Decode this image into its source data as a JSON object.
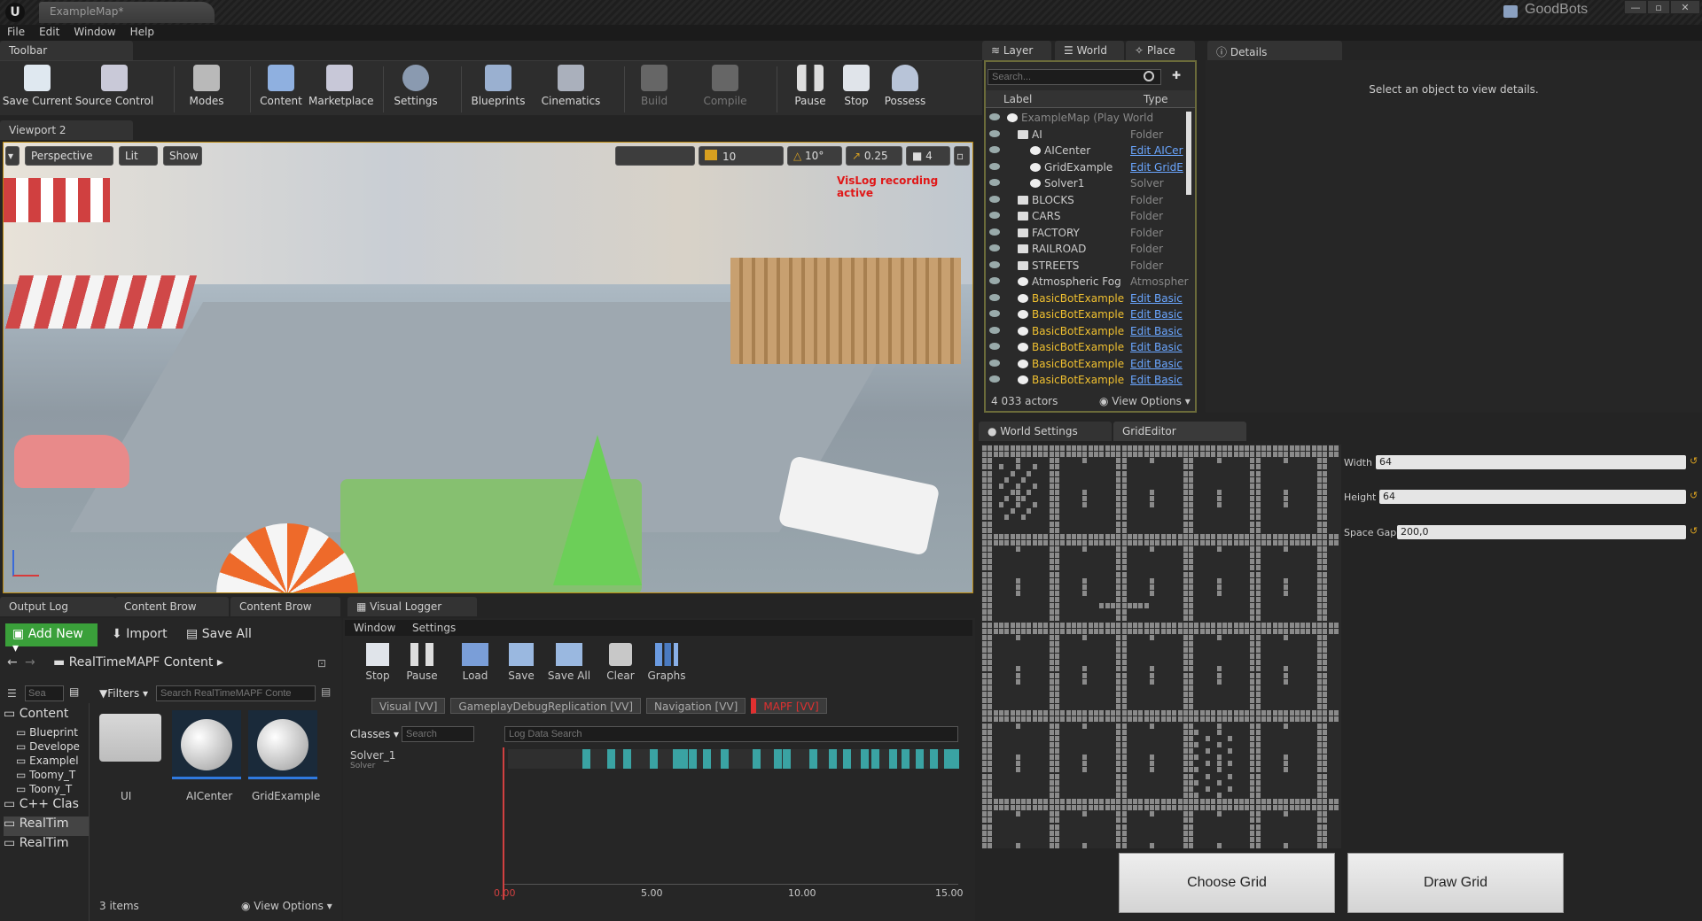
{
  "window": {
    "doc_tab": "ExampleMap*",
    "brand": "GoodBots",
    "logo": "U"
  },
  "menu": [
    "File",
    "Edit",
    "Window",
    "Help"
  ],
  "toolbar": {
    "tab": "Toolbar",
    "buttons": [
      {
        "label": "Save Current",
        "icon": "save-icon"
      },
      {
        "label": "Source Control",
        "icon": "source-control-icon"
      },
      {
        "label": "Modes",
        "icon": "modes-icon"
      },
      {
        "label": "Content",
        "icon": "content-icon"
      },
      {
        "label": "Marketplace",
        "icon": "marketplace-icon"
      },
      {
        "label": "Settings",
        "icon": "settings-icon"
      },
      {
        "label": "Blueprints",
        "icon": "blueprints-icon"
      },
      {
        "label": "Cinematics",
        "icon": "cinematics-icon"
      },
      {
        "label": "Build",
        "icon": "build-icon"
      },
      {
        "label": "Compile",
        "icon": "compile-icon"
      },
      {
        "label": "Pause",
        "icon": "pause-icon"
      },
      {
        "label": "Stop",
        "icon": "stop-icon"
      },
      {
        "label": "Possess",
        "icon": "possess-icon"
      }
    ]
  },
  "viewport": {
    "tab": "Viewport 2",
    "perspective": "Perspective",
    "lit": "Lit",
    "show": "Show",
    "grid_snap": "10",
    "rot_snap": "10°",
    "scale_snap": "0.25",
    "cam_speed": "4",
    "status": "VisLog recording active"
  },
  "outliner": {
    "tabs": [
      "Layer",
      "World",
      "Place"
    ],
    "search_placeholder": "Search...",
    "col_label": "Label",
    "col_type": "Type",
    "rows": [
      {
        "label": "ExampleMap (Play World",
        "type": "",
        "dim": true
      },
      {
        "label": "AI",
        "type": "Folder"
      },
      {
        "label": "AICenter",
        "type": "Edit AICer",
        "link": true
      },
      {
        "label": "GridExample",
        "type": "Edit GridE",
        "link": true
      },
      {
        "label": "Solver1",
        "type": "Solver"
      },
      {
        "label": "BLOCKS",
        "type": "Folder"
      },
      {
        "label": "CARS",
        "type": "Folder"
      },
      {
        "label": "FACTORY",
        "type": "Folder"
      },
      {
        "label": "RAILROAD",
        "type": "Folder"
      },
      {
        "label": "STREETS",
        "type": "Folder"
      },
      {
        "label": "Atmospheric Fog",
        "type": "Atmospher"
      },
      {
        "label": "BasicBotExample",
        "type": "Edit Basic",
        "link": true,
        "hl": true
      },
      {
        "label": "BasicBotExample",
        "type": "Edit Basic",
        "link": true,
        "hl": true
      },
      {
        "label": "BasicBotExample",
        "type": "Edit Basic",
        "link": true,
        "hl": true
      },
      {
        "label": "BasicBotExample",
        "type": "Edit Basic",
        "link": true,
        "hl": true
      },
      {
        "label": "BasicBotExample",
        "type": "Edit Basic",
        "link": true,
        "hl": true
      },
      {
        "label": "BasicBotExample",
        "type": "Edit Basic",
        "link": true,
        "hl": true
      }
    ],
    "actors": "4 033 actors",
    "view_options": "View Options"
  },
  "details": {
    "tab": "Details",
    "empty": "Select an object to view details."
  },
  "grideditor": {
    "tabs": [
      "World Settings",
      "GridEditor"
    ],
    "props": [
      {
        "label": "Width",
        "value": "64"
      },
      {
        "label": "Height",
        "value": "64"
      },
      {
        "label": "Space Gap",
        "value": "200,0"
      }
    ],
    "choose": "Choose Grid",
    "draw": "Draw Grid"
  },
  "content": {
    "tabs": [
      "Output Log",
      "Content Brow",
      "Content Brow"
    ],
    "add_new": "Add New",
    "import": "Import",
    "save_all": "Save All",
    "path": "RealTimeMAPF Content",
    "search_placeholder": "Search RealTimeMAPF Conte",
    "filters": "Filters",
    "tree_search": "Sea",
    "tree": [
      "Content",
      "Blueprint",
      "Develope",
      "Examplel",
      "Toomy_T",
      "Toony_T",
      "C++ Clas",
      "RealTim",
      "RealTim"
    ],
    "items": [
      {
        "label": "UI"
      },
      {
        "label": "AICenter"
      },
      {
        "label": "GridExample"
      }
    ],
    "count": "3 items",
    "view_options": "View Options"
  },
  "vlog": {
    "tab": "Visual Logger",
    "menu": [
      "Window",
      "Settings"
    ],
    "buttons": [
      "Stop",
      "Pause",
      "Load",
      "Save",
      "Save All",
      "Clear",
      "Graphs"
    ],
    "chips": [
      "Visual [VV]",
      "GameplayDebugReplication [VV]",
      "Navigation [VV]",
      "MAPF [VV]"
    ],
    "classes": "Classes",
    "search_placeholder": "Search",
    "log_placeholder": "Log Data Search",
    "row_name": "Solver_1",
    "row_sub": "Solver",
    "ticks": [
      "0.00",
      "5.00",
      "10.00",
      "15.00"
    ]
  }
}
